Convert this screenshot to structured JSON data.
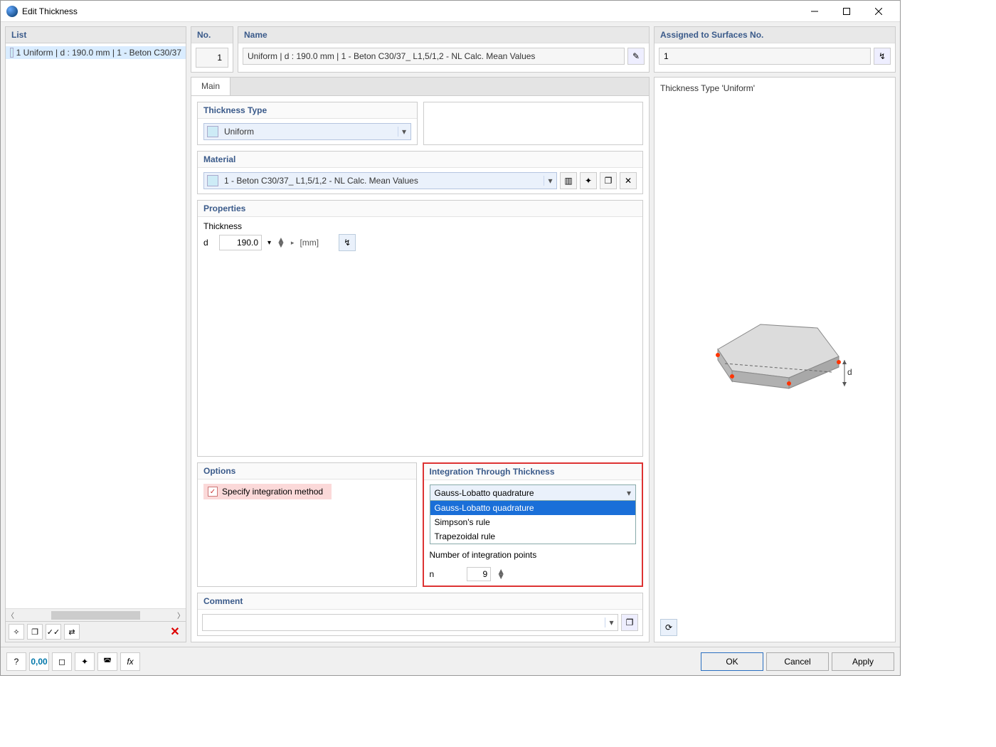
{
  "window": {
    "title": "Edit Thickness"
  },
  "left": {
    "header": "List",
    "items": [
      {
        "num": "1",
        "text": "Uniform | d : 190.0 mm | 1 - Beton C30/37"
      }
    ]
  },
  "row1": {
    "no_label": "No.",
    "no_value": "1",
    "name_label": "Name",
    "name_value": "Uniform | d : 190.0 mm | 1 - Beton C30/37_ L1,5/1,2 - NL Calc. Mean Values",
    "assigned_label": "Assigned to Surfaces No.",
    "assigned_value": "1"
  },
  "tabs": {
    "main": "Main"
  },
  "thickness_type": {
    "label": "Thickness Type",
    "value": "Uniform"
  },
  "material": {
    "label": "Material",
    "value": "1 - Beton C30/37_ L1,5/1,2 - NL Calc. Mean Values"
  },
  "properties": {
    "label": "Properties",
    "sublabel": "Thickness",
    "d_label": "d",
    "d_value": "190.0",
    "unit": "[mm]"
  },
  "options": {
    "label": "Options",
    "specify": "Specify integration method"
  },
  "integration": {
    "label": "Integration Through Thickness",
    "selected": "Gauss-Lobatto quadrature",
    "options": [
      "Gauss-Lobatto quadrature",
      "Simpson's rule",
      "Trapezoidal rule"
    ],
    "nip_label": "Number of integration points",
    "n_label": "n",
    "n_value": "9"
  },
  "comment": {
    "label": "Comment"
  },
  "preview": {
    "text": "Thickness Type  'Uniform'"
  },
  "buttons": {
    "ok": "OK",
    "cancel": "Cancel",
    "apply": "Apply"
  }
}
